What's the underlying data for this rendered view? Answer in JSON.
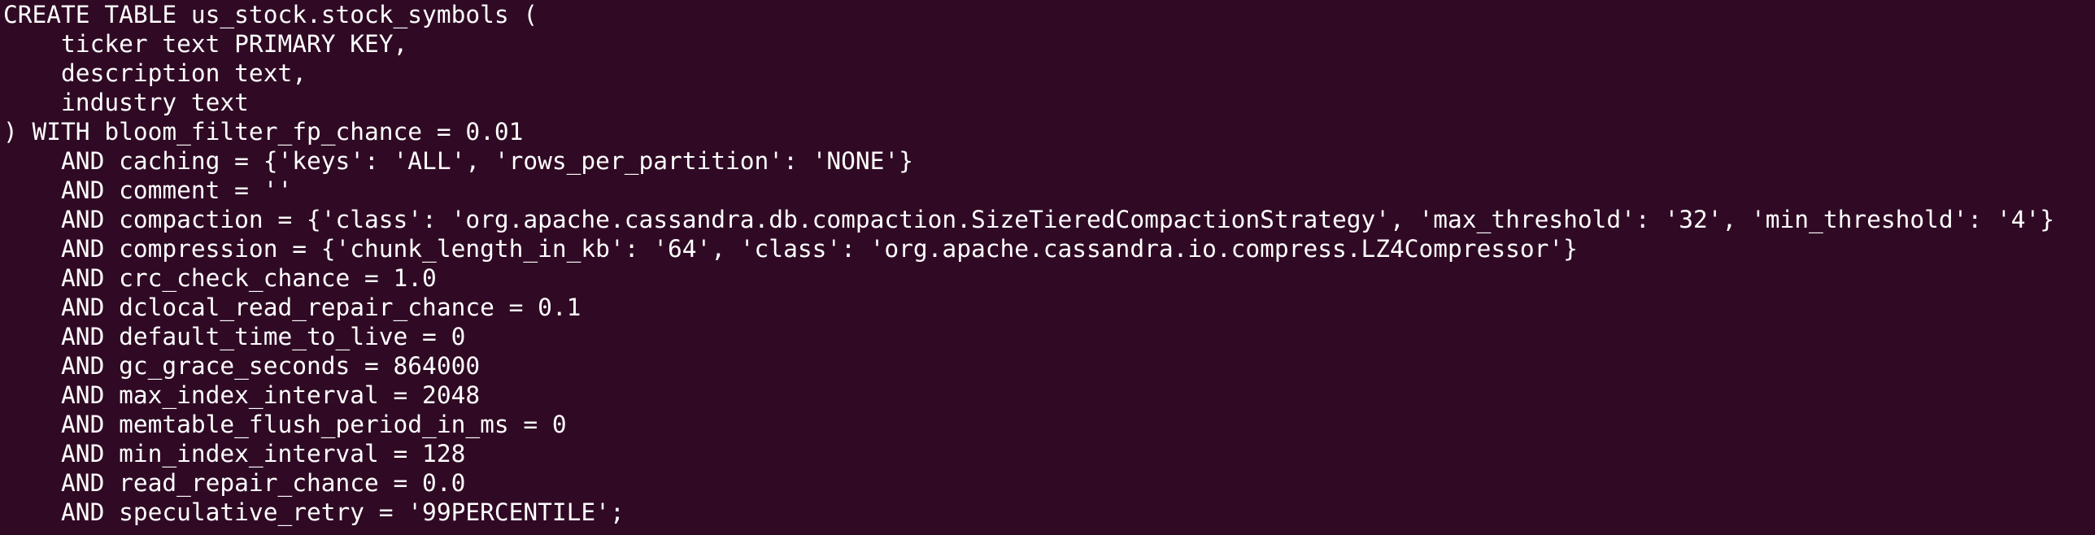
{
  "terminal": {
    "lines": [
      "CREATE TABLE us_stock.stock_symbols (",
      "    ticker text PRIMARY KEY,",
      "    description text,",
      "    industry text",
      ") WITH bloom_filter_fp_chance = 0.01",
      "    AND caching = {'keys': 'ALL', 'rows_per_partition': 'NONE'}",
      "    AND comment = ''",
      "    AND compaction = {'class': 'org.apache.cassandra.db.compaction.SizeTieredCompactionStrategy', 'max_threshold': '32', 'min_threshold': '4'}",
      "    AND compression = {'chunk_length_in_kb': '64', 'class': 'org.apache.cassandra.io.compress.LZ4Compressor'}",
      "    AND crc_check_chance = 1.0",
      "    AND dclocal_read_repair_chance = 0.1",
      "    AND default_time_to_live = 0",
      "    AND gc_grace_seconds = 864000",
      "    AND max_index_interval = 2048",
      "    AND memtable_flush_period_in_ms = 0",
      "    AND min_index_interval = 128",
      "    AND read_repair_chance = 0.0",
      "    AND speculative_retry = '99PERCENTILE';"
    ]
  },
  "colors": {
    "background": "#300a24",
    "text": "#ffffff"
  }
}
